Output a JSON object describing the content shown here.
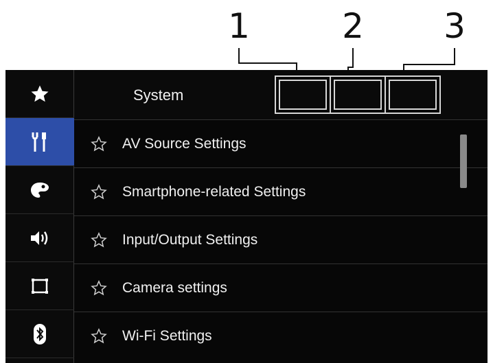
{
  "callouts": [
    "1",
    "2",
    "3"
  ],
  "header": {
    "title": "System",
    "close_icon": "close-icon"
  },
  "sidebar": {
    "items": [
      {
        "icon": "favorites-star-icon",
        "active": false
      },
      {
        "icon": "system-tools-icon",
        "active": true
      },
      {
        "icon": "theme-palette-icon",
        "active": false
      },
      {
        "icon": "audio-speaker-icon",
        "active": false
      },
      {
        "icon": "video-screen-icon",
        "active": false
      },
      {
        "icon": "bluetooth-icon",
        "active": false
      }
    ]
  },
  "menu": {
    "items": [
      {
        "label": "AV Source Settings"
      },
      {
        "label": "Smartphone-related Settings"
      },
      {
        "label": "Input/Output Settings"
      },
      {
        "label": "Camera settings"
      },
      {
        "label": "Wi-Fi Settings"
      }
    ]
  },
  "colors": {
    "active": "#2d4ea8",
    "background": "#070707",
    "text": "#f0f0f0"
  }
}
